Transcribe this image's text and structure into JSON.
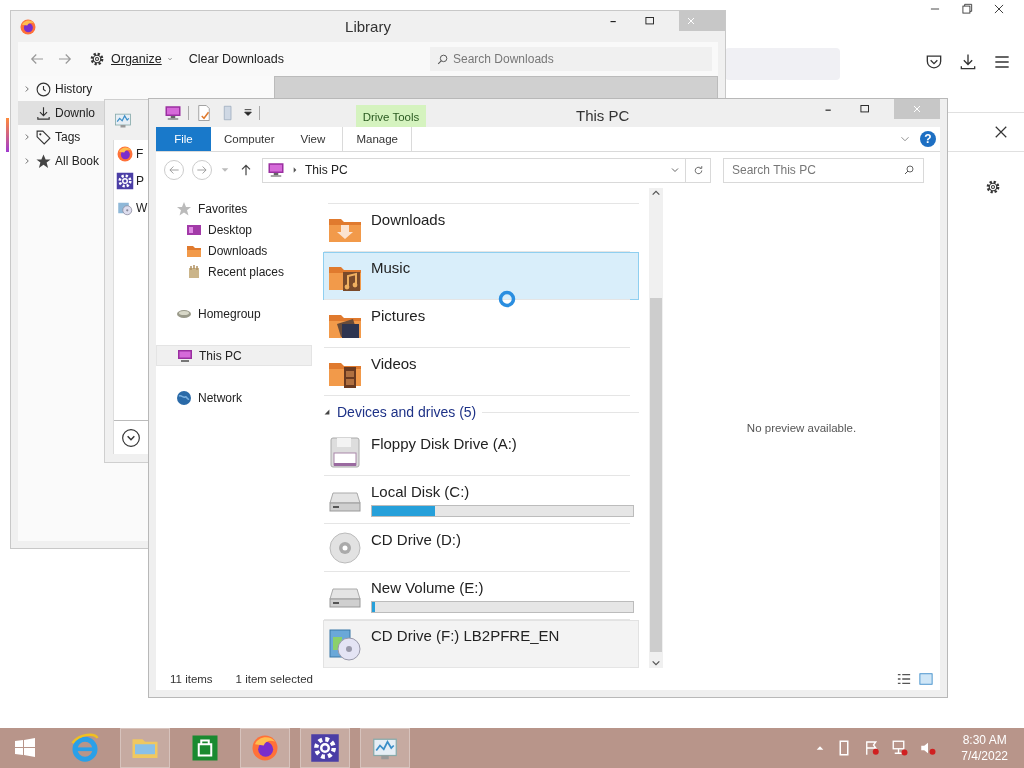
{
  "library": {
    "title": "Library",
    "toolbar": {
      "organize": "Organize",
      "clear": "Clear Downloads",
      "search_placeholder": "Search Downloads"
    },
    "sidebar": [
      {
        "label": "History",
        "kind": "history",
        "expandable": true,
        "selected": false
      },
      {
        "label": "Downlo",
        "kind": "downloads",
        "expandable": false,
        "selected": true
      },
      {
        "label": "Tags",
        "kind": "tags",
        "expandable": true,
        "selected": false
      },
      {
        "label": "All Book",
        "kind": "bookmarks",
        "expandable": true,
        "selected": false
      }
    ]
  },
  "background_window": {
    "items": [
      {
        "label": "F",
        "kind": "firefox"
      },
      {
        "label": "P",
        "kind": "settings"
      },
      {
        "label": "W",
        "kind": "setup"
      }
    ]
  },
  "explorer": {
    "title": "This PC",
    "contextual_group": "Drive Tools",
    "ribbon_tabs": [
      {
        "label": "File",
        "selected": true
      },
      {
        "label": "Computer",
        "selected": false
      },
      {
        "label": "View",
        "selected": false
      },
      {
        "label": "Manage",
        "selected": false
      }
    ],
    "help": "?",
    "address": "This PC",
    "search_placeholder": "Search This PC",
    "navigation": [
      {
        "label": "Favorites",
        "kind": "favorites",
        "selected": false,
        "children": [
          {
            "label": "Desktop",
            "kind": "desktop",
            "selected": false
          },
          {
            "label": "Downloads",
            "kind": "downloads",
            "selected": false
          },
          {
            "label": "Recent places",
            "kind": "recent",
            "selected": false
          }
        ]
      },
      {
        "label": "Homegroup",
        "kind": "homegroup",
        "selected": false
      },
      {
        "label": "This PC",
        "kind": "pc",
        "selected": true
      },
      {
        "label": "Network",
        "kind": "network",
        "selected": false
      }
    ],
    "folders": [
      {
        "name": "Downloads",
        "kind": "downloads",
        "selected": false
      },
      {
        "name": "Music",
        "kind": "music",
        "selected": true
      },
      {
        "name": "Pictures",
        "kind": "pictures",
        "selected": false
      },
      {
        "name": "Videos",
        "kind": "videos",
        "selected": false
      }
    ],
    "devices": {
      "label": "Devices and drives (5)",
      "expanded": true,
      "items": [
        {
          "name": "Floppy Disk Drive (A:)",
          "kind": "floppy",
          "selected": false,
          "hovered": false
        },
        {
          "name": "Local Disk (C:)",
          "kind": "hdd",
          "level": 0.24,
          "selected": false,
          "hovered": false
        },
        {
          "name": "CD Drive (D:)",
          "kind": "cd",
          "selected": false,
          "hovered": false
        },
        {
          "name": "New Volume (E:)",
          "kind": "hdd",
          "level": 0.01,
          "selected": false,
          "hovered": false
        },
        {
          "name": "CD Drive (F:) LB2PFRE_EN",
          "kind": "cd-setup",
          "selected": false,
          "hovered": true
        }
      ]
    },
    "preview": "No preview available.",
    "status": {
      "items": "11 items",
      "selection": "1 item selected"
    }
  },
  "taskbar": {
    "apps": [
      {
        "kind": "browser-e",
        "running": false
      },
      {
        "kind": "file-manager",
        "running": true
      },
      {
        "kind": "store",
        "running": false
      },
      {
        "kind": "firefox",
        "running": true
      },
      {
        "kind": "settings",
        "running": true
      },
      {
        "kind": "monitor",
        "running": true
      }
    ],
    "time": "8:30 AM",
    "date": "7/4/2022"
  }
}
